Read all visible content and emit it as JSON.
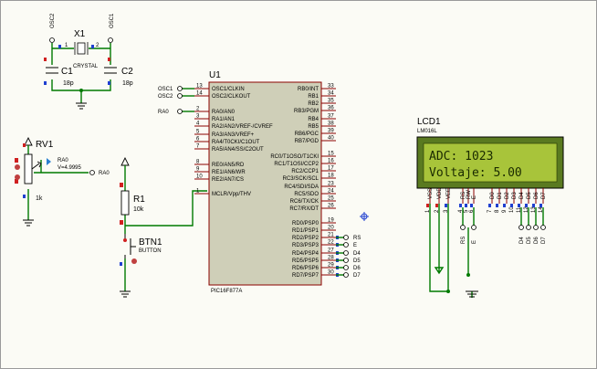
{
  "crystal": {
    "ref": "X1",
    "type": "CRYSTAL",
    "pin1": "1",
    "pin2": "2",
    "net_left": "OSC2",
    "net_right": "OSC1"
  },
  "caps": [
    {
      "ref": "C1",
      "value": "18p"
    },
    {
      "ref": "C2",
      "value": "18p"
    }
  ],
  "pot": {
    "ref": "RV1",
    "value": "1k",
    "probe_net": "RA0",
    "probe_reading": "V=4.9995",
    "net_label": "RA0"
  },
  "resistor": {
    "ref": "R1",
    "value": "10k"
  },
  "button": {
    "ref": "BTN1",
    "type": "BUTTON"
  },
  "mcu": {
    "ref": "U1",
    "part": "PIC16F877A",
    "left_pins": [
      {
        "num": "13",
        "name": "OSC1/CLKIN",
        "net": "OSC1"
      },
      {
        "num": "14",
        "name": "OSC2/CLKOUT",
        "net": "OSC2"
      },
      {
        "num": "2",
        "name": "RA0/AN0",
        "net": "RA0"
      },
      {
        "num": "3",
        "name": "RA1/AN1",
        "net": ""
      },
      {
        "num": "4",
        "name": "RA2/AN2/VREF-/CVREF",
        "net": ""
      },
      {
        "num": "5",
        "name": "RA3/AN3/VREF+",
        "net": ""
      },
      {
        "num": "6",
        "name": "RA4/T0CKI/C1OUT",
        "net": ""
      },
      {
        "num": "7",
        "name": "RA5/AN4/SS/C2OUT",
        "net": ""
      },
      {
        "num": "8",
        "name": "RE0/AN5/RD",
        "net": ""
      },
      {
        "num": "9",
        "name": "RE1/AN6/WR",
        "net": ""
      },
      {
        "num": "10",
        "name": "RE2/AN7/CS",
        "net": ""
      },
      {
        "num": "1",
        "name": "MCLR/Vpp/THV",
        "net": ""
      }
    ],
    "right_pins": [
      {
        "num": "33",
        "name": "RB0/INT",
        "net": ""
      },
      {
        "num": "34",
        "name": "RB1",
        "net": ""
      },
      {
        "num": "35",
        "name": "RB2",
        "net": ""
      },
      {
        "num": "36",
        "name": "RB3/PGM",
        "net": ""
      },
      {
        "num": "37",
        "name": "RB4",
        "net": ""
      },
      {
        "num": "38",
        "name": "RB5",
        "net": ""
      },
      {
        "num": "39",
        "name": "RB6/PGC",
        "net": ""
      },
      {
        "num": "40",
        "name": "RB7/PGD",
        "net": ""
      },
      {
        "num": "15",
        "name": "RC0/T1OSO/T1CKI",
        "net": ""
      },
      {
        "num": "16",
        "name": "RC1/T1OSI/CCP2",
        "net": ""
      },
      {
        "num": "17",
        "name": "RC2/CCP1",
        "net": ""
      },
      {
        "num": "18",
        "name": "RC3/SCK/SCL",
        "net": ""
      },
      {
        "num": "23",
        "name": "RC4/SDI/SDA",
        "net": ""
      },
      {
        "num": "24",
        "name": "RC5/SDO",
        "net": ""
      },
      {
        "num": "25",
        "name": "RC6/TX/CK",
        "net": ""
      },
      {
        "num": "26",
        "name": "RC7/RX/DT",
        "net": ""
      },
      {
        "num": "19",
        "name": "RD0/PSP0",
        "net": ""
      },
      {
        "num": "20",
        "name": "RD1/PSP1",
        "net": ""
      },
      {
        "num": "21",
        "name": "RD2/PSP2",
        "net": "RS"
      },
      {
        "num": "22",
        "name": "RD3/PSP3",
        "net": "E"
      },
      {
        "num": "27",
        "name": "RD4/PSP4",
        "net": "D4"
      },
      {
        "num": "28",
        "name": "RD5/PSP5",
        "net": "D5"
      },
      {
        "num": "29",
        "name": "RD6/PSP6",
        "net": "D6"
      },
      {
        "num": "30",
        "name": "RD7/PSP7",
        "net": "D7"
      }
    ]
  },
  "lcd": {
    "ref": "LCD1",
    "part": "LM016L",
    "line1": "ADC: 1023",
    "line2": "Voltaje: 5.00",
    "pins": [
      {
        "name": "VSS",
        "num": "1"
      },
      {
        "name": "VDD",
        "num": "2"
      },
      {
        "name": "VEE",
        "num": "3"
      },
      {
        "name": "RS",
        "num": "4"
      },
      {
        "name": "RW",
        "num": "5"
      },
      {
        "name": "E",
        "num": "6"
      },
      {
        "name": "D0",
        "num": "7"
      },
      {
        "name": "D1",
        "num": "8"
      },
      {
        "name": "D2",
        "num": "9"
      },
      {
        "name": "D3",
        "num": "10"
      },
      {
        "name": "D4",
        "num": "11"
      },
      {
        "name": "D5",
        "num": "12"
      },
      {
        "name": "D6",
        "num": "13"
      },
      {
        "name": "D7",
        "num": "14"
      }
    ],
    "net_labels": [
      "RS",
      "E",
      "D4",
      "D5",
      "D6",
      "D7"
    ]
  },
  "colors": {
    "wire": "#007a00",
    "pin": "#8b0000",
    "chip": "#cfcfb8",
    "lcd_bg": "#a8c43a"
  }
}
